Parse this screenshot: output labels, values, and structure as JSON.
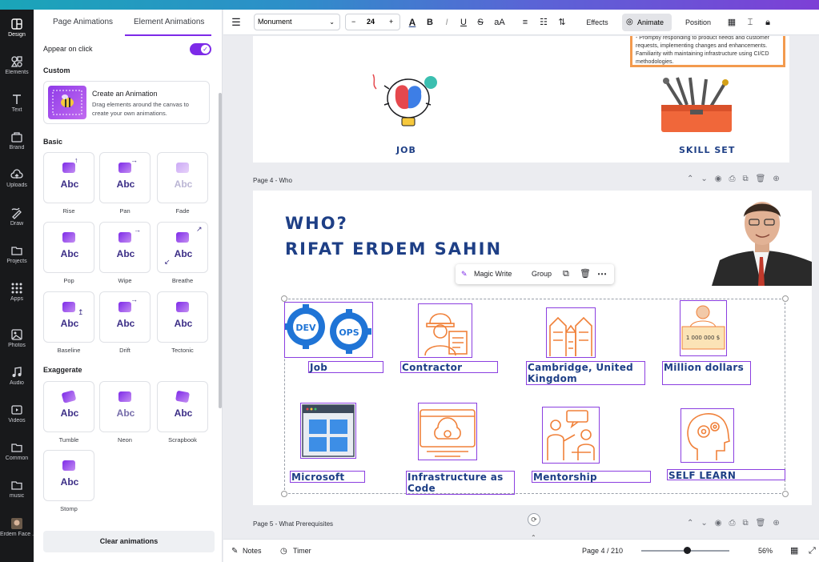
{
  "rail": {
    "items": [
      {
        "label": "Design",
        "icon": "design-icon"
      },
      {
        "label": "Elements",
        "icon": "elements-icon"
      },
      {
        "label": "Text",
        "icon": "text-icon"
      },
      {
        "label": "Brand",
        "icon": "brand-icon"
      },
      {
        "label": "Uploads",
        "icon": "uploads-icon"
      },
      {
        "label": "Draw",
        "icon": "draw-icon"
      },
      {
        "label": "Projects",
        "icon": "projects-icon"
      },
      {
        "label": "Apps",
        "icon": "apps-icon"
      },
      {
        "label": "Photos",
        "icon": "photos-icon"
      },
      {
        "label": "Audio",
        "icon": "audio-icon"
      },
      {
        "label": "Videos",
        "icon": "videos-icon"
      },
      {
        "label": "Common",
        "icon": "folder-icon"
      },
      {
        "label": "music",
        "icon": "folder-icon"
      },
      {
        "label": "Erdem Face ...",
        "icon": "avatar-thumb"
      }
    ]
  },
  "panel": {
    "tabs": [
      "Page Animations",
      "Element Animations"
    ],
    "appear_on_click": "Appear on click",
    "custom_label": "Custom",
    "create_title": "Create an Animation",
    "create_desc": "Drag elements around the canvas to create your own animations.",
    "basic_label": "Basic",
    "exaggerate_label": "Exaggerate",
    "abc": "Abc",
    "basic": [
      "Rise",
      "Pan",
      "Fade",
      "Pop",
      "Wipe",
      "Breathe",
      "Baseline",
      "Drift",
      "Tectonic"
    ],
    "exaggerate": [
      "Tumble",
      "Neon",
      "Scrapbook",
      "Stomp"
    ],
    "clear": "Clear animations"
  },
  "toolbar": {
    "font": "Monument",
    "size": "24",
    "minus": "−",
    "plus": "+",
    "case": "aA",
    "effects": "Effects",
    "animate": "Animate",
    "position": "Position"
  },
  "canvas": {
    "page3_note": "- Promptly responding to product needs and customer requests, implementing changes and enhancements. Familiarity with maintaining infrastructure using CI/CD methodologies.",
    "page3_caps": [
      "JOB",
      "SKILL SET"
    ],
    "page4_label": "Page 4 - Who",
    "heading1": "WHO?",
    "heading2": "RIFAT ERDEM  SAHIN",
    "context_menu": {
      "magic": "Magic Write",
      "group": "Group"
    },
    "devops_left": "DEV",
    "devops_right": "OPS",
    "money_text": "1 000 000 $",
    "items": [
      "Job",
      "Contractor",
      "Cambridge, United Kingdom",
      "Million dollars",
      "Microsoft",
      "Infrastructure as Code",
      "Mentorship",
      "SELF LEARN"
    ],
    "page5_label": "Page 5 - What Prerequisites"
  },
  "bottombar": {
    "notes": "Notes",
    "timer": "Timer",
    "page": "Page 4 / 210",
    "zoom": "56%"
  },
  "colors": {
    "accent": "#7d2ae8",
    "heading": "#1e3f86",
    "orange": "#f39a4e",
    "selection": "#8b3fe0"
  }
}
